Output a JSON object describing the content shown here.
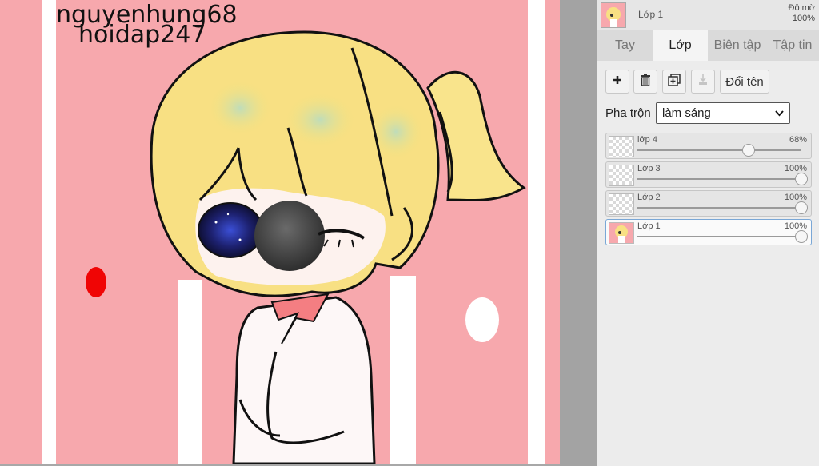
{
  "canvas": {
    "watermark_line1": "nguyenhung68",
    "watermark_line2": "hoidap247"
  },
  "panel": {
    "header": {
      "layer_name": "Lớp 1",
      "opacity_label": "Độ mờ",
      "opacity_value": "100%"
    },
    "tabs": [
      {
        "label": "Tay",
        "active": false
      },
      {
        "label": "Lớp",
        "active": true
      },
      {
        "label": "Biên tập",
        "active": false
      },
      {
        "label": "Tập tin",
        "active": false
      }
    ],
    "toolbar": {
      "add_icon": "plus-icon",
      "delete_icon": "trash-icon",
      "duplicate_icon": "duplicate-icon",
      "merge_icon": "merge-down-icon",
      "rename_label": "Đổi tên"
    },
    "blend": {
      "label": "Pha trộn",
      "value": "làm sáng"
    },
    "layers": [
      {
        "name": "lớp 4",
        "opacity": "68%",
        "opacity_fraction": 0.68,
        "active": false
      },
      {
        "name": "Lớp 3",
        "opacity": "100%",
        "opacity_fraction": 1.0,
        "active": false
      },
      {
        "name": "Lớp 2",
        "opacity": "100%",
        "opacity_fraction": 1.0,
        "active": false
      },
      {
        "name": "Lớp 1",
        "opacity": "100%",
        "opacity_fraction": 1.0,
        "active": true
      }
    ]
  }
}
